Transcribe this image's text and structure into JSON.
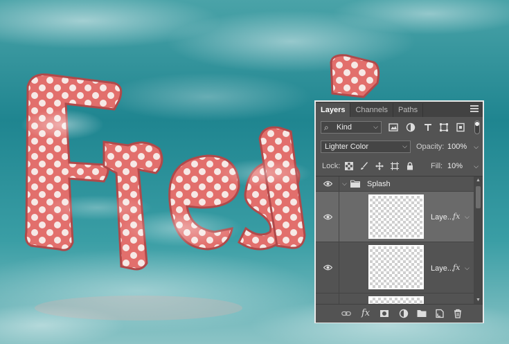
{
  "panel": {
    "tabs": [
      {
        "label": "Layers",
        "active": true
      },
      {
        "label": "Channels",
        "active": false
      },
      {
        "label": "Paths",
        "active": false
      }
    ],
    "filter": {
      "kind_label": "Kind",
      "icons": [
        "image-filter-icon",
        "adjustment-filter-icon",
        "type-filter-icon",
        "shape-filter-icon",
        "smart-object-filter-icon"
      ]
    },
    "blend_mode": "Lighter Color",
    "opacity_label": "Opacity:",
    "opacity_value": "100%",
    "lock_label": "Lock:",
    "fill_label": "Fill:",
    "fill_value": "10%",
    "layers": [
      {
        "type": "group",
        "name": "Splash",
        "visible": true
      },
      {
        "type": "layer",
        "name": "Laye...",
        "visible": true,
        "selected": true,
        "has_fx": true
      },
      {
        "type": "layer",
        "name": "Laye...",
        "visible": true,
        "selected": false,
        "has_fx": true
      },
      {
        "type": "layer",
        "name": "",
        "visible": false,
        "selected": false,
        "has_fx": false
      }
    ],
    "fx_symbol": "fx",
    "bottom_icons": [
      "link-layers-icon",
      "add-style-icon",
      "add-mask-icon",
      "new-adjustment-icon",
      "new-group-icon",
      "new-layer-icon",
      "delete-layer-icon"
    ]
  },
  "colors": {
    "panel_bg": "#535353",
    "selected_row": "#6a6a6a",
    "water": "#2a8f97",
    "letter": "#e06b6a"
  }
}
